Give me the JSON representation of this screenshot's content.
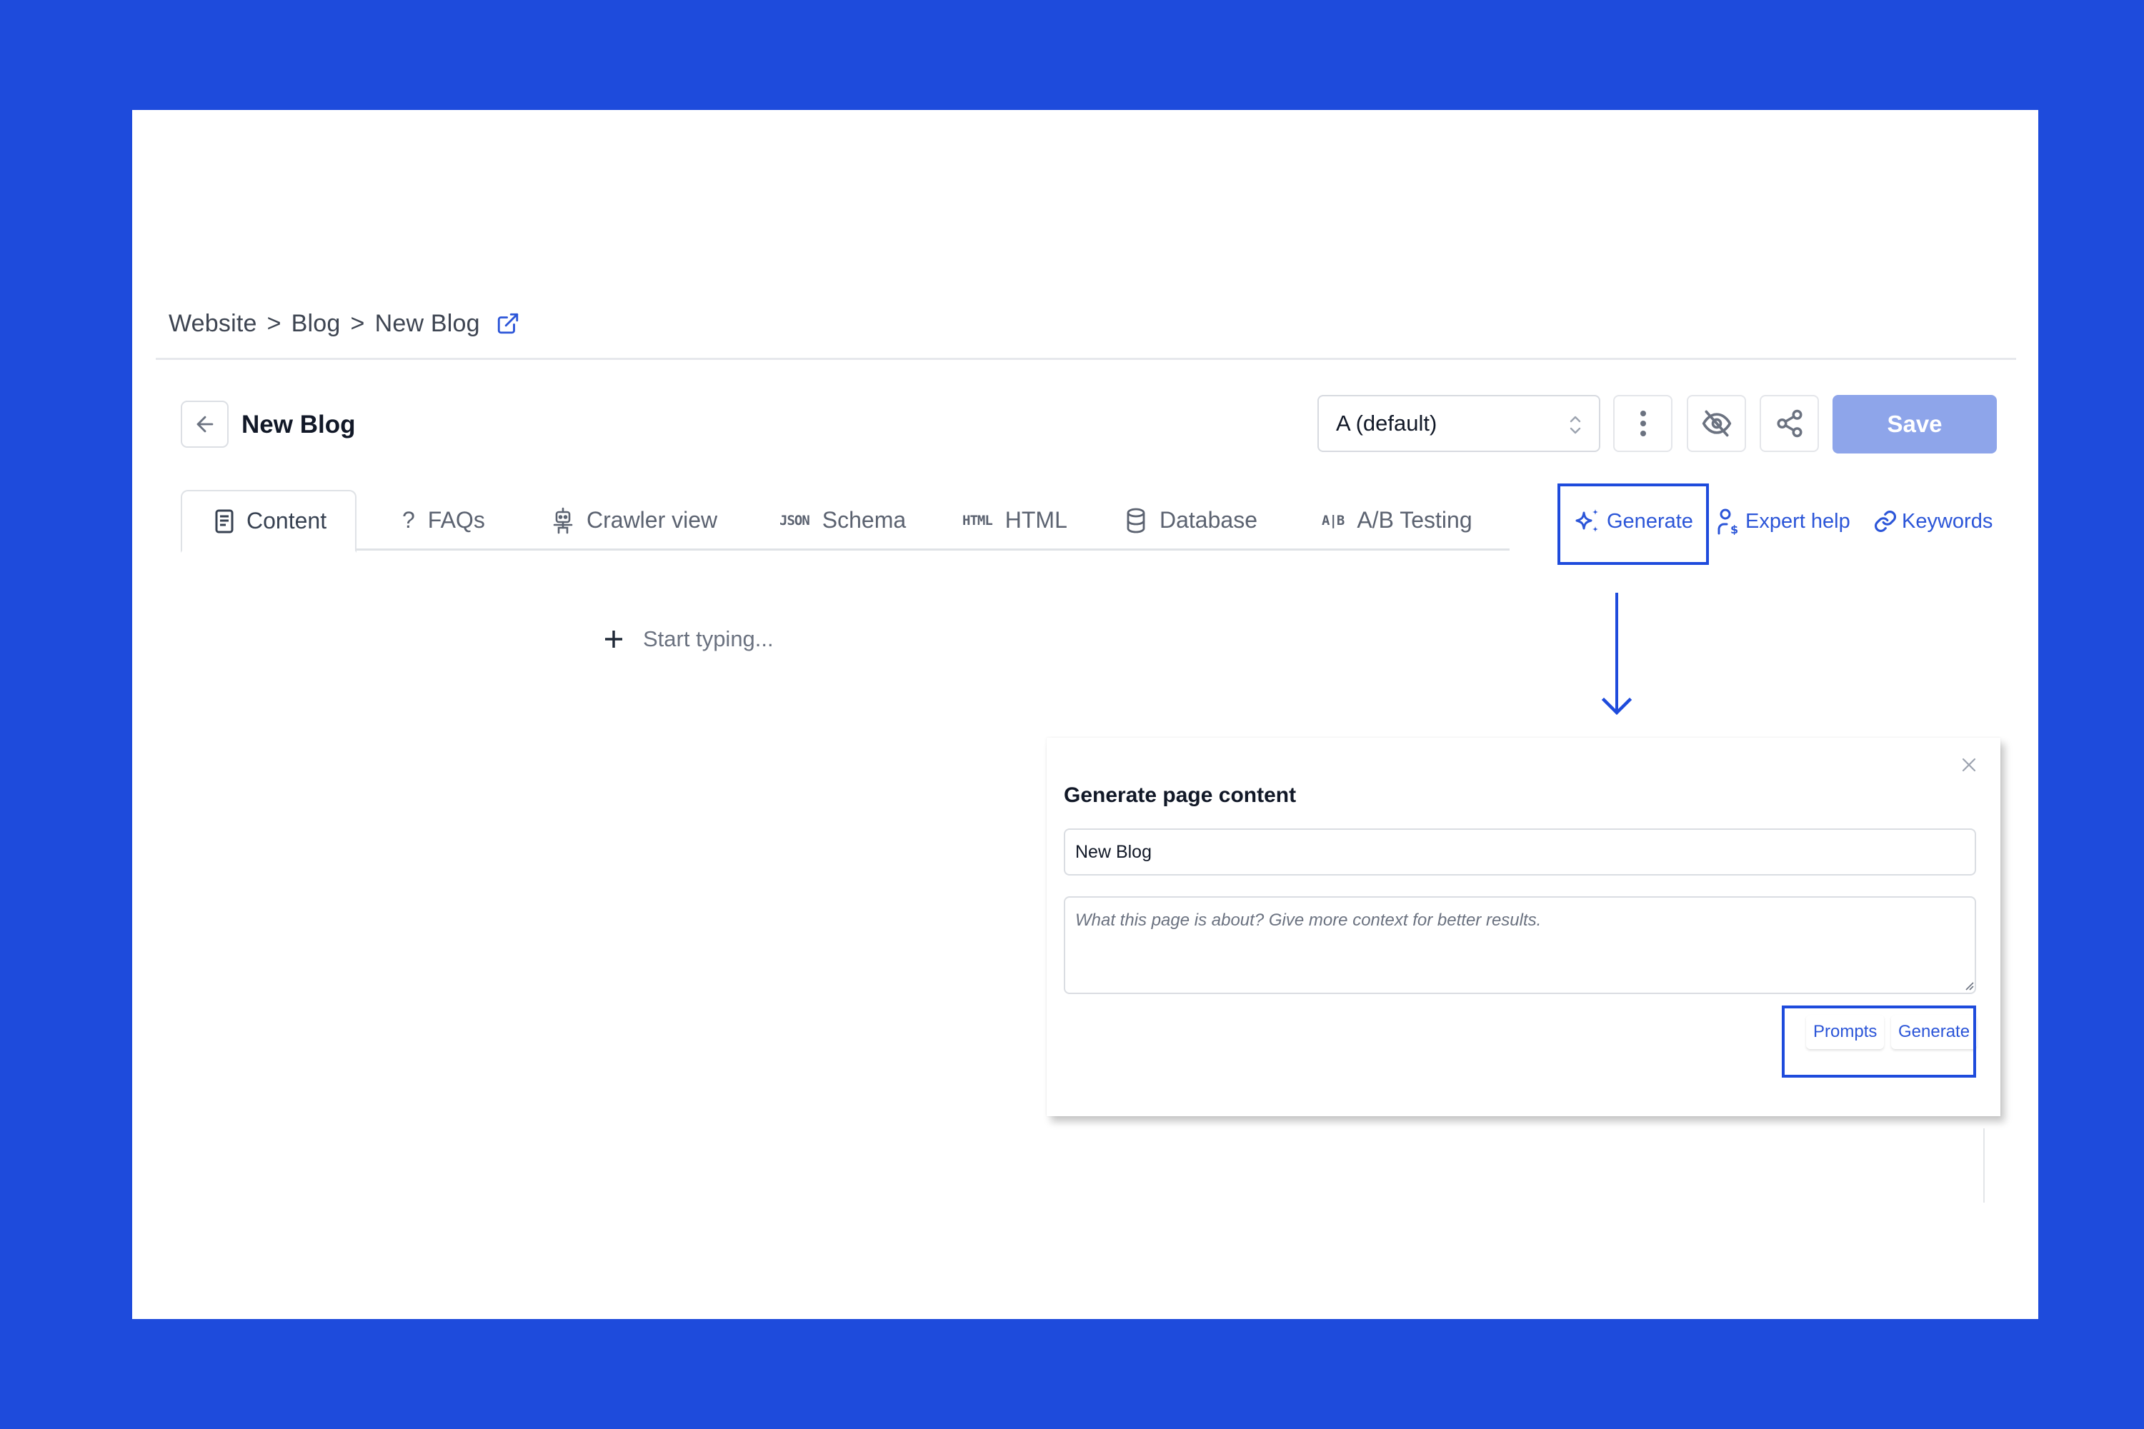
{
  "breadcrumb": {
    "items": [
      "Website",
      "Blog",
      "New Blog"
    ],
    "separator": ">",
    "external_link_icon": "external-link-icon"
  },
  "header": {
    "back_icon": "arrow-left-icon",
    "title": "New Blog",
    "variant_select": {
      "value": "A (default)",
      "icon": "chevron-up-down-icon"
    },
    "more_icon": "more-vertical-icon",
    "visibility_icon": "eye-off-icon",
    "share_icon": "share-icon",
    "save_label": "Save"
  },
  "tabs": [
    {
      "label": "Content",
      "icon": "document-icon",
      "active": true
    },
    {
      "label": "FAQs",
      "icon": "question-icon",
      "icon_text": "?"
    },
    {
      "label": "Crawler view",
      "icon": "robot-icon"
    },
    {
      "label": "Schema",
      "icon": "json-icon",
      "icon_text": "JSON"
    },
    {
      "label": "HTML",
      "icon": "html-icon",
      "icon_text": "HTML"
    },
    {
      "label": "Database",
      "icon": "database-icon"
    },
    {
      "label": "A/B Testing",
      "icon": "ab-icon",
      "icon_text": "A|B"
    }
  ],
  "actions": [
    {
      "label": "Generate",
      "icon": "sparkles-icon",
      "highlighted": true
    },
    {
      "label": "Expert help",
      "icon": "user-dollar-icon"
    },
    {
      "label": "Keywords",
      "icon": "link-icon"
    }
  ],
  "editor": {
    "add_icon": "plus-icon",
    "placeholder": "Start typing..."
  },
  "modal": {
    "title": "Generate page content",
    "close_icon": "close-icon",
    "title_input_value": "New Blog",
    "context_placeholder": "What this page is about? Give more context for better results.",
    "prompts_label": "Prompts",
    "generate_label": "Generate"
  },
  "colors": {
    "frame_background": "#1e4bdc",
    "accent": "#2b55d8",
    "save_button": "#8ea5ea",
    "highlight": "#1e4bdc"
  }
}
